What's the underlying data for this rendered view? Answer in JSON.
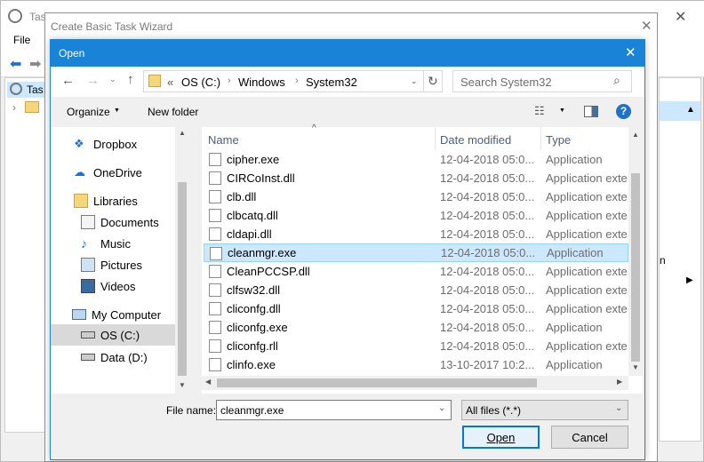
{
  "background": {
    "title": "Tas",
    "menu_file": "File",
    "tree_item": "Tas",
    "right_fragment": "n"
  },
  "wizard": {
    "title": "Create Basic Task Wizard"
  },
  "dialog": {
    "title": "Open",
    "breadcrumb": [
      "OS (C:)",
      "Windows",
      "System32"
    ],
    "breadcrumb_prefix": "«",
    "search_placeholder": "Search System32",
    "organize": "Organize",
    "new_folder": "New folder",
    "nav": [
      {
        "label": "Dropbox",
        "icon": "dropbox-icon"
      },
      {
        "label": "OneDrive",
        "icon": "cloud-icon"
      },
      {
        "label": "Libraries",
        "icon": "libraries-icon"
      },
      {
        "label": "Documents",
        "icon": "document-icon"
      },
      {
        "label": "Music",
        "icon": "music-icon"
      },
      {
        "label": "Pictures",
        "icon": "picture-icon"
      },
      {
        "label": "Videos",
        "icon": "video-icon"
      },
      {
        "label": "My Computer",
        "icon": "computer-icon"
      },
      {
        "label": "OS (C:)",
        "icon": "drive-icon"
      },
      {
        "label": "Data (D:)",
        "icon": "drive-icon"
      }
    ],
    "columns": {
      "name": "Name",
      "date": "Date modified",
      "type": "Type"
    },
    "files": [
      {
        "name": "cipher.exe",
        "date": "12-04-2018 05:0...",
        "type": "Application"
      },
      {
        "name": "CIRCoInst.dll",
        "date": "12-04-2018 05:0...",
        "type": "Application exte"
      },
      {
        "name": "clb.dll",
        "date": "12-04-2018 05:0...",
        "type": "Application exte"
      },
      {
        "name": "clbcatq.dll",
        "date": "12-04-2018 05:0...",
        "type": "Application exte"
      },
      {
        "name": "cldapi.dll",
        "date": "12-04-2018 05:0...",
        "type": "Application exte"
      },
      {
        "name": "cleanmgr.exe",
        "date": "12-04-2018 05:0...",
        "type": "Application"
      },
      {
        "name": "CleanPCCSP.dll",
        "date": "12-04-2018 05:0...",
        "type": "Application exte"
      },
      {
        "name": "clfsw32.dll",
        "date": "12-04-2018 05:0...",
        "type": "Application exte"
      },
      {
        "name": "cliconfg.dll",
        "date": "12-04-2018 05:0...",
        "type": "Application exte"
      },
      {
        "name": "cliconfg.exe",
        "date": "12-04-2018 05:0...",
        "type": "Application"
      },
      {
        "name": "cliconfg.rll",
        "date": "12-04-2018 05:0...",
        "type": "Application exte"
      },
      {
        "name": "clinfo.exe",
        "date": "13-10-2017 10:2...",
        "type": "Application"
      }
    ],
    "file_name_label": "File name:",
    "file_name_value": "cleanmgr.exe",
    "filter": "All files (*.*)",
    "open_button": "Open",
    "cancel_button": "Cancel"
  },
  "colors": {
    "accent": "#1883d7",
    "selection": "#cce8ff"
  }
}
